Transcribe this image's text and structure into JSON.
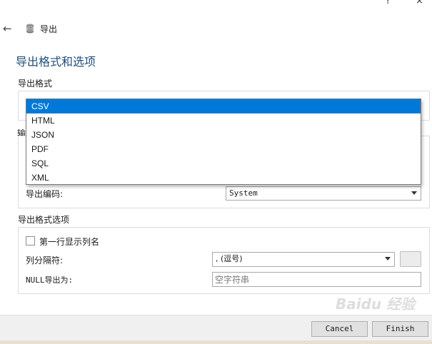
{
  "window": {
    "help_glyph": "?",
    "close_glyph": "×"
  },
  "header": {
    "back_icon": "arrow-left-icon",
    "db_icon": "database-icon",
    "title": "导出"
  },
  "page_title": "导出格式和选项",
  "export_format": {
    "section_label": "导出格式",
    "options": [
      "CSV",
      "HTML",
      "JSON",
      "PDF",
      "SQL",
      "XML"
    ],
    "selected_index": 0
  },
  "hidden_section_label": "输",
  "encoding": {
    "label": "导出编码:",
    "value": "System"
  },
  "format_options": {
    "section_label": "导出格式选项",
    "show_column_names_label": "第一行显示列名",
    "show_column_names_checked": false,
    "separator_label": "列分隔符:",
    "separator_value": ", (逗号)",
    "null_label": "NULL导出为:",
    "null_placeholder": "空字符串"
  },
  "footer": {
    "cancel_label": "Cancel",
    "finish_label": "Finish"
  },
  "watermark": "Baidu 经验",
  "colors": {
    "accent": "#0078d7",
    "title": "#1f4e79"
  }
}
